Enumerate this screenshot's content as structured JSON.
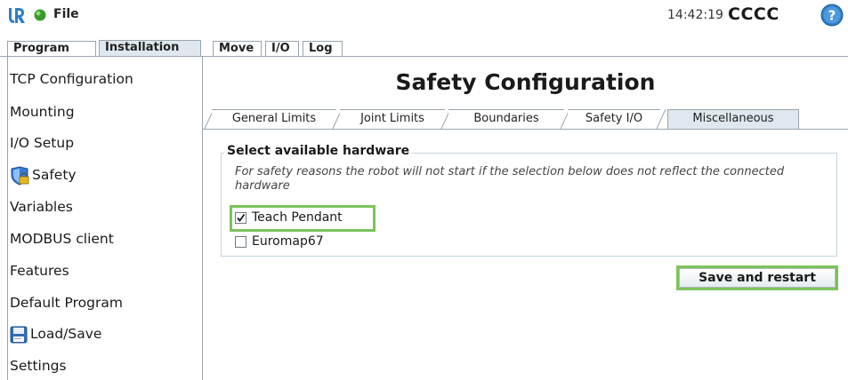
{
  "topbar": {
    "file_label": "File",
    "clock": "14:42:19",
    "robot_name": "CCCC",
    "logo_icon": "ur-logo-icon",
    "status_icon": "status-dot-icon",
    "help_icon": "help-icon"
  },
  "main_tabs": [
    {
      "label": "Program",
      "active": false
    },
    {
      "label": "Installation",
      "active": true
    },
    {
      "label": "Move",
      "active": false
    },
    {
      "label": "I/O",
      "active": false
    },
    {
      "label": "Log",
      "active": false
    }
  ],
  "sidebar": {
    "items": [
      {
        "label": "TCP Configuration"
      },
      {
        "label": "Mounting"
      },
      {
        "label": "I/O Setup"
      },
      {
        "label": "Safety",
        "icon": "safety-shield-lock-icon"
      },
      {
        "label": "Variables"
      },
      {
        "label": "MODBUS client"
      },
      {
        "label": "Features"
      },
      {
        "label": "Default Program"
      },
      {
        "label": "Load/Save",
        "icon": "floppy-disk-icon"
      },
      {
        "label": "Settings"
      }
    ]
  },
  "main": {
    "title": "Safety Configuration",
    "tabs": [
      {
        "label": "General Limits",
        "active": false
      },
      {
        "label": "Joint Limits",
        "active": false
      },
      {
        "label": "Boundaries",
        "active": false
      },
      {
        "label": "Safety I/O",
        "active": false
      },
      {
        "label": "Miscellaneous",
        "active": true
      }
    ],
    "hardware": {
      "legend": "Select available hardware",
      "note": "For safety reasons the robot will not start if the selection below does not reflect the connected hardware",
      "options": [
        {
          "label": "Teach Pendant",
          "checked": true
        },
        {
          "label": "Euromap67",
          "checked": false
        }
      ]
    },
    "save_button": "Save and restart"
  },
  "colors": {
    "highlight": "#7cc35a",
    "active_tab": "#dfe8ee",
    "border": "#9aa4ad",
    "ur_blue": "#2f7fc8",
    "status_green": "#3c9a2c"
  }
}
